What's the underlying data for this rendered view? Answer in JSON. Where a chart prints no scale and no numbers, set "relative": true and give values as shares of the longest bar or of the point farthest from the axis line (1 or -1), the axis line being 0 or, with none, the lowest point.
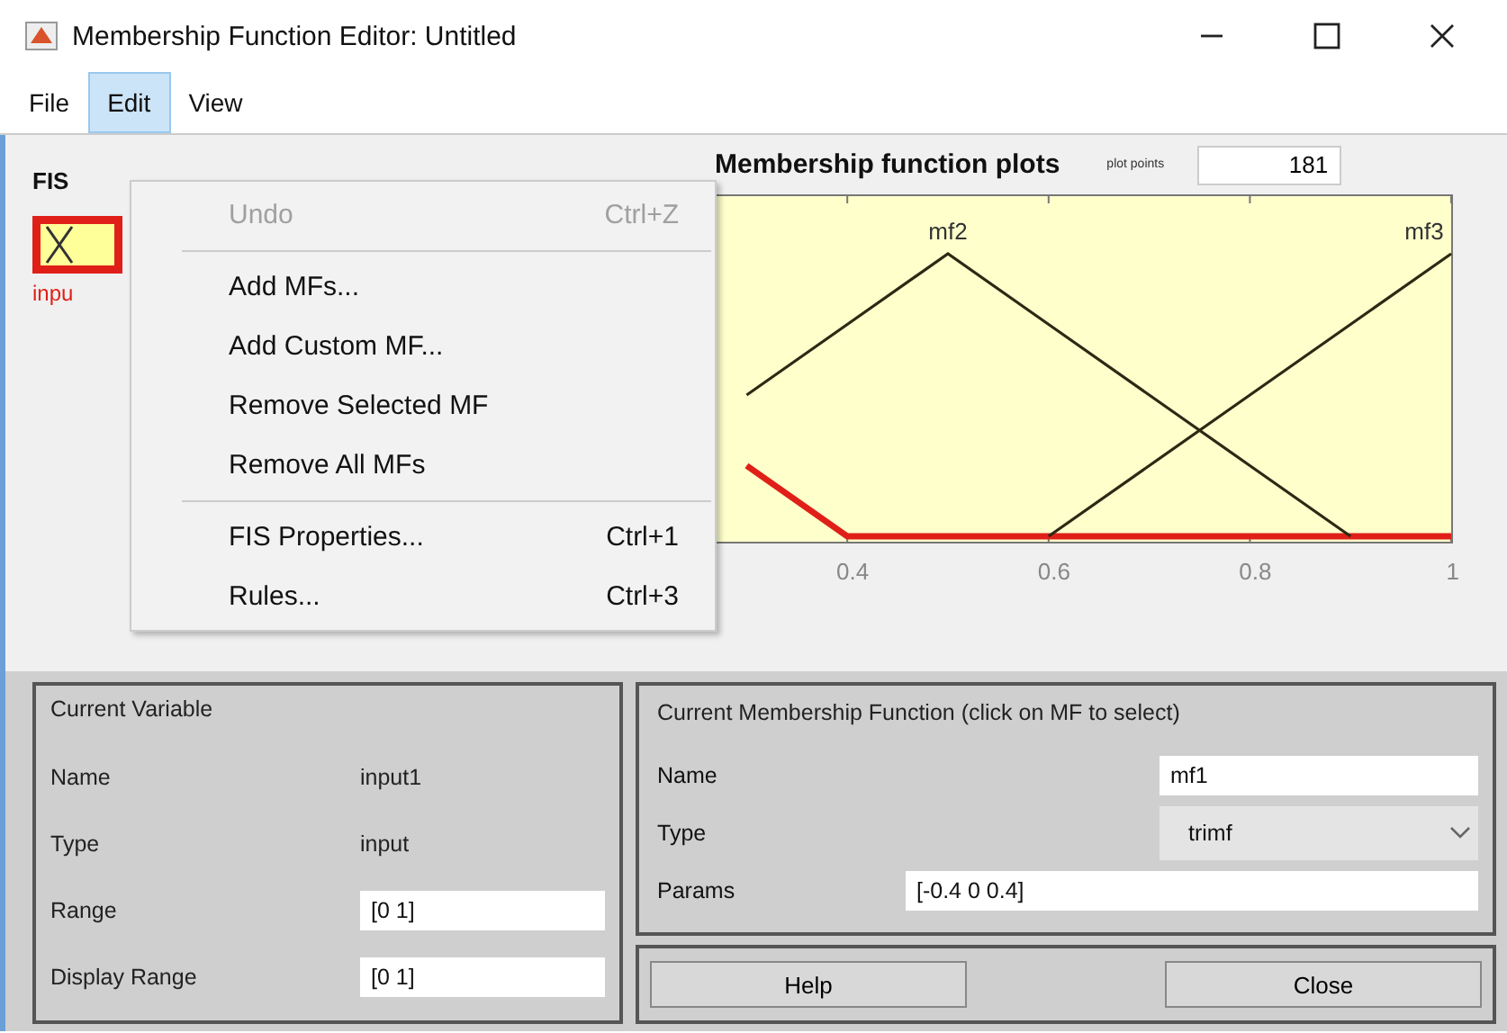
{
  "window": {
    "title": "Membership Function Editor: Untitled"
  },
  "menu_bar": [
    {
      "label": "File",
      "selected": false
    },
    {
      "label": "Edit",
      "selected": true
    },
    {
      "label": "View",
      "selected": false
    }
  ],
  "edit_menu": {
    "groups": [
      [
        {
          "label": "Undo",
          "shortcut": "Ctrl+Z",
          "disabled": true
        }
      ],
      [
        {
          "label": "Add MFs...",
          "disabled": false
        },
        {
          "label": "Add Custom MF...",
          "disabled": false
        },
        {
          "label": "Remove Selected MF",
          "disabled": false
        },
        {
          "label": "Remove All MFs",
          "disabled": false
        }
      ],
      [
        {
          "label": "FIS Properties...",
          "shortcut": "Ctrl+1",
          "disabled": false
        },
        {
          "label": "Rules...",
          "shortcut": "Ctrl+3",
          "disabled": false
        }
      ]
    ]
  },
  "fis_variables": {
    "label": "FIS",
    "variables": [
      {
        "name": "inpu",
        "selected": true
      }
    ]
  },
  "plot": {
    "title": "Membership function plots",
    "points_label": "plot points",
    "points": "181",
    "chart_data": {
      "type": "line",
      "x": [
        0.3,
        0.4,
        0.5,
        0.6,
        0.7,
        0.8,
        0.9,
        1
      ],
      "xlim": [
        0,
        1
      ],
      "relative": true,
      "xticks": [
        0.4,
        0.6,
        0.8,
        1
      ],
      "series": [
        {
          "color": "#e02018",
          "values": [
            0.25,
            0,
            0,
            0,
            0,
            0,
            0,
            0
          ]
        },
        {
          "name": "mf2",
          "color": "#2a2a14",
          "values": [
            0.5,
            0.75,
            1,
            0.75,
            0.5,
            0.25,
            0,
            null
          ]
        },
        {
          "name": "mf3",
          "color": "#2a2a14",
          "values": [
            null,
            null,
            null,
            0,
            0.25,
            0.5,
            0.75,
            1
          ]
        }
      ]
    }
  },
  "current_variable": {
    "title": "Current Variable",
    "rows": [
      {
        "label": "Name",
        "value": "input1",
        "kind": "text"
      },
      {
        "label": "Type",
        "value": "input",
        "kind": "text"
      },
      {
        "label": "Range",
        "value": "[0 1]",
        "kind": "field"
      },
      {
        "label": "Display Range",
        "value": "[0 1]",
        "kind": "field"
      }
    ]
  },
  "current_mf": {
    "title": "Current Membership Function (click on MF to select)",
    "rows": [
      {
        "label": "Name",
        "value": "mf1",
        "kind": "field"
      },
      {
        "label": "Type",
        "value": "trimf",
        "kind": "dropdown"
      },
      {
        "label": "Params",
        "value": "[-0.4 0 0.4]",
        "kind": "wide"
      }
    ]
  },
  "buttons": [
    "Help",
    "Close"
  ]
}
